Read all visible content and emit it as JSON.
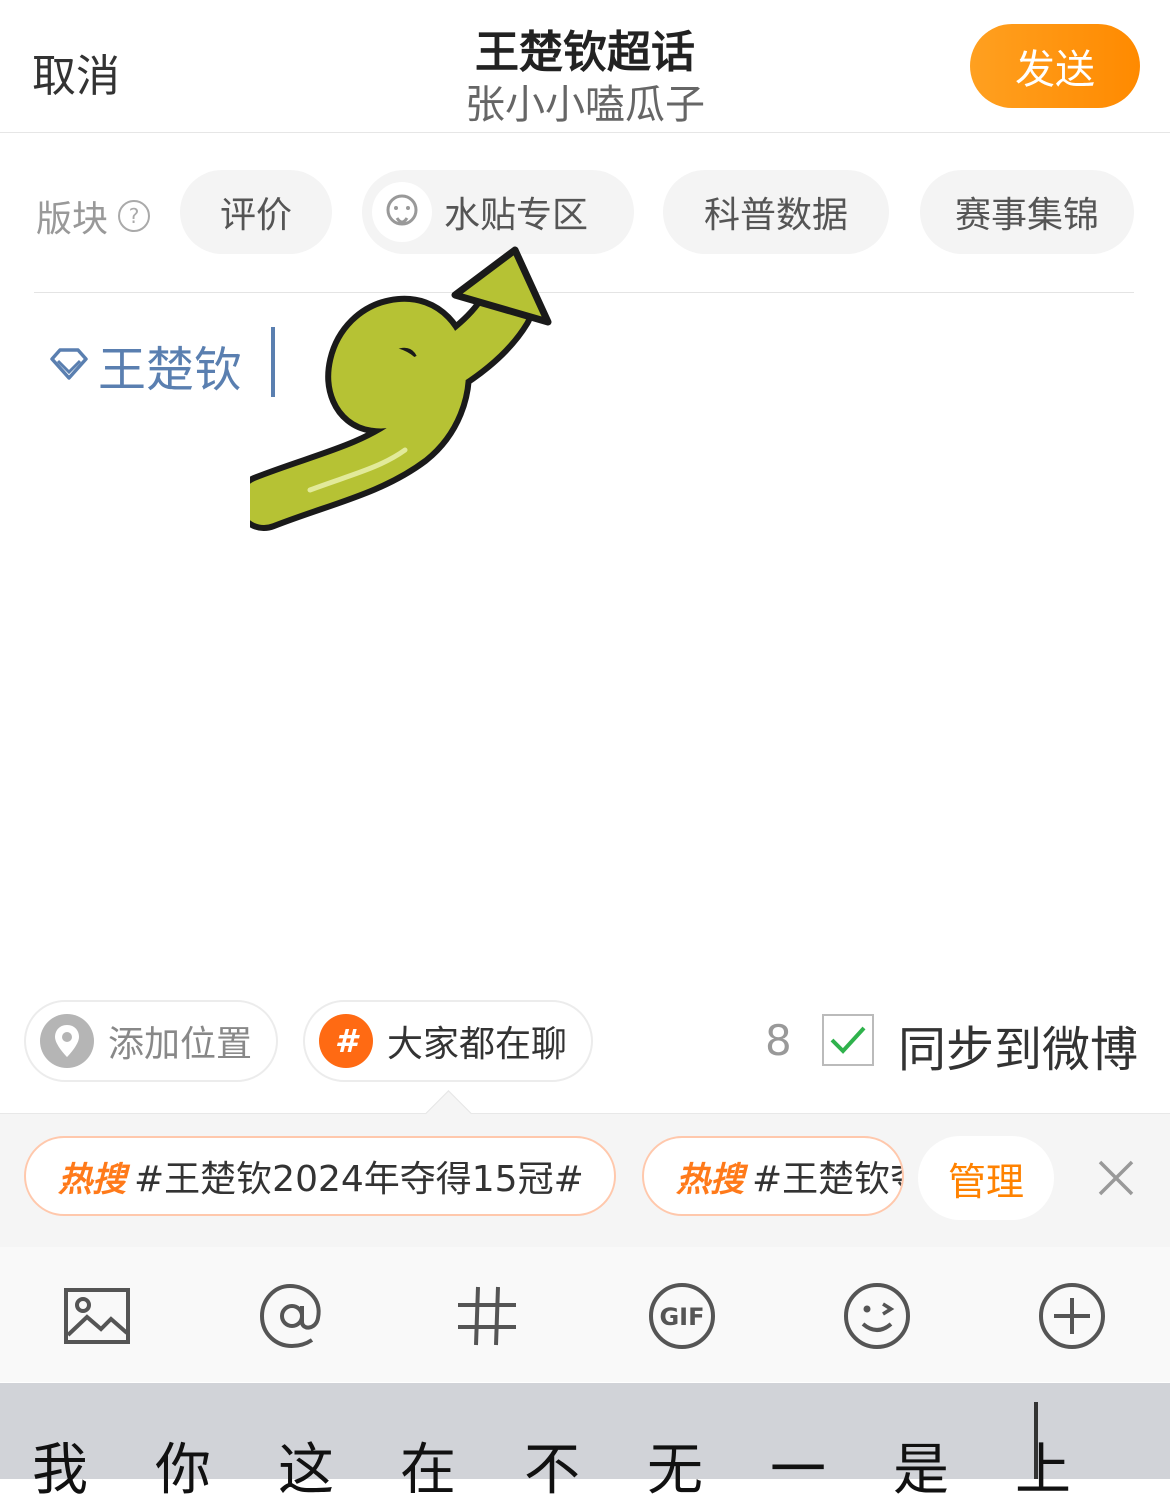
{
  "header": {
    "cancel_label": "取消",
    "title": "王楚钦超话",
    "subtitle": "张小小嗑瓜子",
    "send_label": "发送"
  },
  "sections": {
    "label": "版块",
    "help_icon": "question-circle-icon",
    "items": [
      {
        "label": "评价"
      },
      {
        "label": "水贴专区",
        "icon": "face-icon",
        "selected": true
      },
      {
        "label": "科普数据"
      },
      {
        "label": "赛事集锦"
      }
    ]
  },
  "editor": {
    "topic_icon": "diamond-icon",
    "topic_text": "王楚钦"
  },
  "sticker": {
    "icon": "green-curly-arrow-icon"
  },
  "actions": {
    "location_label": "添加位置",
    "topic_label": "大家都在聊",
    "count": "8",
    "sync_label": "同步到微博",
    "sync_checked": true
  },
  "hot_search": {
    "items": [
      {
        "badge": "热搜",
        "text": "#王楚钦2024年夺得15冠#"
      },
      {
        "badge": "热搜",
        "text": "#王楚钦夺"
      }
    ],
    "manage_label": "管理",
    "accent": "#ff7a1a"
  },
  "toolbar": {
    "icons": [
      "image-icon",
      "at-icon",
      "hashtag-icon",
      "gif-icon",
      "emoji-icon",
      "plus-circle-icon"
    ]
  },
  "keyboard": {
    "candidates": [
      "我",
      "你",
      "这",
      "在",
      "不",
      "无",
      "一",
      "是",
      "上"
    ]
  },
  "colors": {
    "brand": "#ff8a00",
    "topic_blue": "#5a7fb0",
    "check_green": "#2fb24c"
  }
}
